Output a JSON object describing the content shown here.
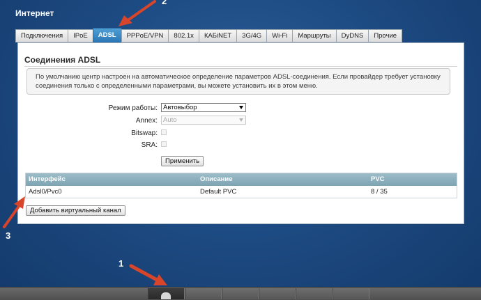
{
  "page": {
    "title": "Интернет"
  },
  "tabs": [
    {
      "label": "Подключения"
    },
    {
      "label": "IPoE"
    },
    {
      "label": "ADSL",
      "active": true
    },
    {
      "label": "PPPoE/VPN"
    },
    {
      "label": "802.1x"
    },
    {
      "label": "КАБiNET"
    },
    {
      "label": "3G/4G"
    },
    {
      "label": "Wi-Fi"
    },
    {
      "label": "Маршруты"
    },
    {
      "label": "DyDNS"
    },
    {
      "label": "Прочие"
    }
  ],
  "section": {
    "title": "Соединения ADSL",
    "info": "По умолчанию центр настроен на автоматическое определение параметров ADSL-соединения. Если провайдер требует установку соединения только с определенными параметрами, вы можете установить их в этом меню."
  },
  "form": {
    "mode_label": "Режим работы:",
    "mode_value": "Автовыбор",
    "annex_label": "Annex:",
    "annex_value": "Auto",
    "bitswap_label": "Bitswap:",
    "sra_label": "SRA:",
    "apply_label": "Применить"
  },
  "table": {
    "headers": [
      "Интерфейс",
      "Описание",
      "PVC"
    ],
    "rows": [
      [
        "Adsl0/Pvc0",
        "Default PVC",
        "8 / 35"
      ]
    ]
  },
  "add_channel_label": "Добавить виртуальный канал",
  "annotations": [
    "1",
    "2",
    "3"
  ],
  "colors": {
    "active_tab": "#2c78b8",
    "table_header": "#7ea4b3",
    "arrow": "#d9452a",
    "background": "#1d4b83"
  }
}
